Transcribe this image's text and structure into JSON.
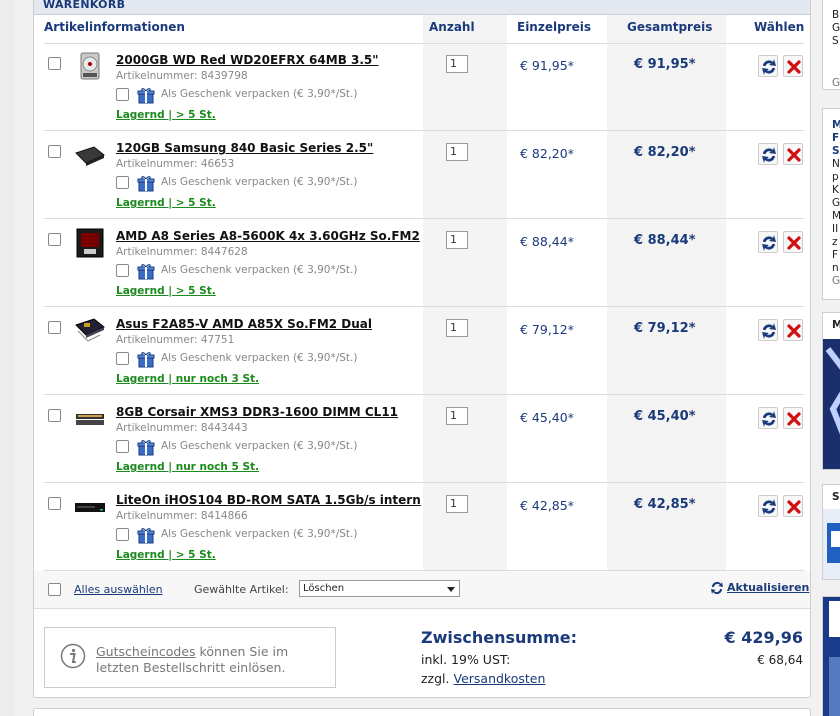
{
  "cart": {
    "heading": "WARENKORB",
    "columns": {
      "info": "Artikelinformationen",
      "qty": "Anzahl",
      "unit": "Einzelpreis",
      "total": "Gesamtpreis",
      "select": "Wählen"
    },
    "gift_label": "Als Geschenk verpacken (€ 3,90*/St.)",
    "items": [
      {
        "name": "2000GB WD Red WD20EFRX 64MB 3.5\"",
        "art_label": "Artikelnummer:",
        "art": "8439798",
        "stock": "Lagernd | > 5 St.",
        "qty": "1",
        "unit_price": "€ 91,95*",
        "total_price": "€ 91,95*",
        "thumb": "hdd"
      },
      {
        "name": "120GB Samsung 840 Basic Series 2.5\"",
        "art_label": "Artikelnummer:",
        "art": "46653",
        "stock": "Lagernd | > 5 St.",
        "qty": "1",
        "unit_price": "€ 82,20*",
        "total_price": "€ 82,20*",
        "thumb": "ssd"
      },
      {
        "name": "AMD A8 Series A8-5600K 4x 3.60GHz So.FM2",
        "art_label": "Artikelnummer:",
        "art": "8447628",
        "stock": "Lagernd | > 5 St.",
        "qty": "1",
        "unit_price": "€ 88,44*",
        "total_price": "€ 88,44*",
        "thumb": "cpu"
      },
      {
        "name": "Asus F2A85-V AMD A85X So.FM2 Dual",
        "art_label": "Artikelnummer:",
        "art": "47751",
        "stock": "Lagernd | nur noch 3 St.",
        "qty": "1",
        "unit_price": "€ 79,12*",
        "total_price": "€ 79,12*",
        "thumb": "board"
      },
      {
        "name": "8GB Corsair XMS3 DDR3-1600 DIMM CL11",
        "art_label": "Artikelnummer:",
        "art": "8443443",
        "stock": "Lagernd | nur noch 5 St.",
        "qty": "1",
        "unit_price": "€ 45,40*",
        "total_price": "€ 45,40*",
        "thumb": "ram"
      },
      {
        "name": "LiteOn iHOS104 BD-ROM SATA 1.5Gb/s intern",
        "art_label": "Artikelnummer:",
        "art": "8414866",
        "stock": "Lagernd | > 5 St.",
        "qty": "1",
        "unit_price": "€ 42,85*",
        "total_price": "€ 42,85*",
        "thumb": "drive"
      }
    ],
    "footer": {
      "select_all": "Alles auswählen",
      "chosen_label": "Gewählte Artikel:",
      "action_value": "Löschen",
      "update": "Aktualisieren"
    },
    "voucher": {
      "link": "Gutscheincodes",
      "text": " können Sie im letzten Bestellschritt einlösen."
    },
    "summary": {
      "subtotal_label": "Zwischensumme:",
      "subtotal_value": "€ 429,96",
      "vat_label": "inkl. 19% UST:",
      "vat_value": "€ 68,64",
      "shipping_prefix": "zzgl. ",
      "shipping_link": "Versandkosten"
    }
  },
  "right_sidebar": {
    "box1": [
      "B",
      "G",
      "S"
    ],
    "box1_bottom": "G",
    "box2": [
      "M",
      "F",
      "S",
      "N",
      "p",
      "K",
      "G",
      "M",
      "II",
      "z",
      "F",
      "n",
      "G"
    ],
    "box3": "M",
    "box4": "S"
  },
  "colors": {
    "accent": "#1a3a7a",
    "stock": "#1a8a1a",
    "delete": "#d01010"
  }
}
